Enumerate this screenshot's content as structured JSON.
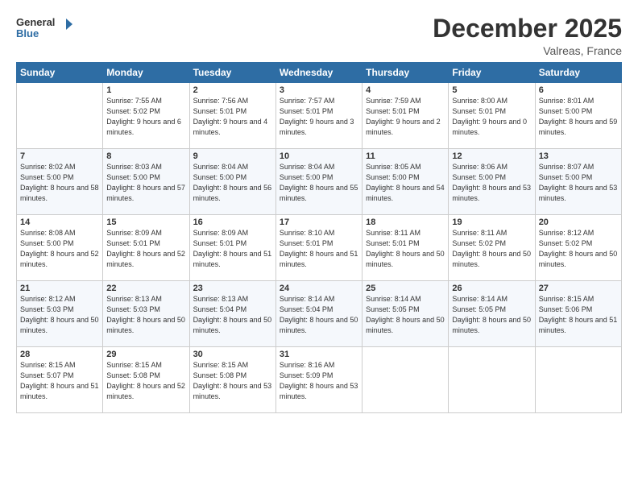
{
  "logo": {
    "line1": "General",
    "line2": "Blue"
  },
  "title": "December 2025",
  "location": "Valreas, France",
  "weekdays": [
    "Sunday",
    "Monday",
    "Tuesday",
    "Wednesday",
    "Thursday",
    "Friday",
    "Saturday"
  ],
  "weeks": [
    [
      {
        "day": "",
        "sunrise": "",
        "sunset": "",
        "daylight": ""
      },
      {
        "day": "1",
        "sunrise": "Sunrise: 7:55 AM",
        "sunset": "Sunset: 5:02 PM",
        "daylight": "Daylight: 9 hours and 6 minutes."
      },
      {
        "day": "2",
        "sunrise": "Sunrise: 7:56 AM",
        "sunset": "Sunset: 5:01 PM",
        "daylight": "Daylight: 9 hours and 4 minutes."
      },
      {
        "day": "3",
        "sunrise": "Sunrise: 7:57 AM",
        "sunset": "Sunset: 5:01 PM",
        "daylight": "Daylight: 9 hours and 3 minutes."
      },
      {
        "day": "4",
        "sunrise": "Sunrise: 7:59 AM",
        "sunset": "Sunset: 5:01 PM",
        "daylight": "Daylight: 9 hours and 2 minutes."
      },
      {
        "day": "5",
        "sunrise": "Sunrise: 8:00 AM",
        "sunset": "Sunset: 5:01 PM",
        "daylight": "Daylight: 9 hours and 0 minutes."
      },
      {
        "day": "6",
        "sunrise": "Sunrise: 8:01 AM",
        "sunset": "Sunset: 5:00 PM",
        "daylight": "Daylight: 8 hours and 59 minutes."
      }
    ],
    [
      {
        "day": "7",
        "sunrise": "Sunrise: 8:02 AM",
        "sunset": "Sunset: 5:00 PM",
        "daylight": "Daylight: 8 hours and 58 minutes."
      },
      {
        "day": "8",
        "sunrise": "Sunrise: 8:03 AM",
        "sunset": "Sunset: 5:00 PM",
        "daylight": "Daylight: 8 hours and 57 minutes."
      },
      {
        "day": "9",
        "sunrise": "Sunrise: 8:04 AM",
        "sunset": "Sunset: 5:00 PM",
        "daylight": "Daylight: 8 hours and 56 minutes."
      },
      {
        "day": "10",
        "sunrise": "Sunrise: 8:04 AM",
        "sunset": "Sunset: 5:00 PM",
        "daylight": "Daylight: 8 hours and 55 minutes."
      },
      {
        "day": "11",
        "sunrise": "Sunrise: 8:05 AM",
        "sunset": "Sunset: 5:00 PM",
        "daylight": "Daylight: 8 hours and 54 minutes."
      },
      {
        "day": "12",
        "sunrise": "Sunrise: 8:06 AM",
        "sunset": "Sunset: 5:00 PM",
        "daylight": "Daylight: 8 hours and 53 minutes."
      },
      {
        "day": "13",
        "sunrise": "Sunrise: 8:07 AM",
        "sunset": "Sunset: 5:00 PM",
        "daylight": "Daylight: 8 hours and 53 minutes."
      }
    ],
    [
      {
        "day": "14",
        "sunrise": "Sunrise: 8:08 AM",
        "sunset": "Sunset: 5:00 PM",
        "daylight": "Daylight: 8 hours and 52 minutes."
      },
      {
        "day": "15",
        "sunrise": "Sunrise: 8:09 AM",
        "sunset": "Sunset: 5:01 PM",
        "daylight": "Daylight: 8 hours and 52 minutes."
      },
      {
        "day": "16",
        "sunrise": "Sunrise: 8:09 AM",
        "sunset": "Sunset: 5:01 PM",
        "daylight": "Daylight: 8 hours and 51 minutes."
      },
      {
        "day": "17",
        "sunrise": "Sunrise: 8:10 AM",
        "sunset": "Sunset: 5:01 PM",
        "daylight": "Daylight: 8 hours and 51 minutes."
      },
      {
        "day": "18",
        "sunrise": "Sunrise: 8:11 AM",
        "sunset": "Sunset: 5:01 PM",
        "daylight": "Daylight: 8 hours and 50 minutes."
      },
      {
        "day": "19",
        "sunrise": "Sunrise: 8:11 AM",
        "sunset": "Sunset: 5:02 PM",
        "daylight": "Daylight: 8 hours and 50 minutes."
      },
      {
        "day": "20",
        "sunrise": "Sunrise: 8:12 AM",
        "sunset": "Sunset: 5:02 PM",
        "daylight": "Daylight: 8 hours and 50 minutes."
      }
    ],
    [
      {
        "day": "21",
        "sunrise": "Sunrise: 8:12 AM",
        "sunset": "Sunset: 5:03 PM",
        "daylight": "Daylight: 8 hours and 50 minutes."
      },
      {
        "day": "22",
        "sunrise": "Sunrise: 8:13 AM",
        "sunset": "Sunset: 5:03 PM",
        "daylight": "Daylight: 8 hours and 50 minutes."
      },
      {
        "day": "23",
        "sunrise": "Sunrise: 8:13 AM",
        "sunset": "Sunset: 5:04 PM",
        "daylight": "Daylight: 8 hours and 50 minutes."
      },
      {
        "day": "24",
        "sunrise": "Sunrise: 8:14 AM",
        "sunset": "Sunset: 5:04 PM",
        "daylight": "Daylight: 8 hours and 50 minutes."
      },
      {
        "day": "25",
        "sunrise": "Sunrise: 8:14 AM",
        "sunset": "Sunset: 5:05 PM",
        "daylight": "Daylight: 8 hours and 50 minutes."
      },
      {
        "day": "26",
        "sunrise": "Sunrise: 8:14 AM",
        "sunset": "Sunset: 5:05 PM",
        "daylight": "Daylight: 8 hours and 50 minutes."
      },
      {
        "day": "27",
        "sunrise": "Sunrise: 8:15 AM",
        "sunset": "Sunset: 5:06 PM",
        "daylight": "Daylight: 8 hours and 51 minutes."
      }
    ],
    [
      {
        "day": "28",
        "sunrise": "Sunrise: 8:15 AM",
        "sunset": "Sunset: 5:07 PM",
        "daylight": "Daylight: 8 hours and 51 minutes."
      },
      {
        "day": "29",
        "sunrise": "Sunrise: 8:15 AM",
        "sunset": "Sunset: 5:08 PM",
        "daylight": "Daylight: 8 hours and 52 minutes."
      },
      {
        "day": "30",
        "sunrise": "Sunrise: 8:15 AM",
        "sunset": "Sunset: 5:08 PM",
        "daylight": "Daylight: 8 hours and 53 minutes."
      },
      {
        "day": "31",
        "sunrise": "Sunrise: 8:16 AM",
        "sunset": "Sunset: 5:09 PM",
        "daylight": "Daylight: 8 hours and 53 minutes."
      },
      {
        "day": "",
        "sunrise": "",
        "sunset": "",
        "daylight": ""
      },
      {
        "day": "",
        "sunrise": "",
        "sunset": "",
        "daylight": ""
      },
      {
        "day": "",
        "sunrise": "",
        "sunset": "",
        "daylight": ""
      }
    ]
  ]
}
